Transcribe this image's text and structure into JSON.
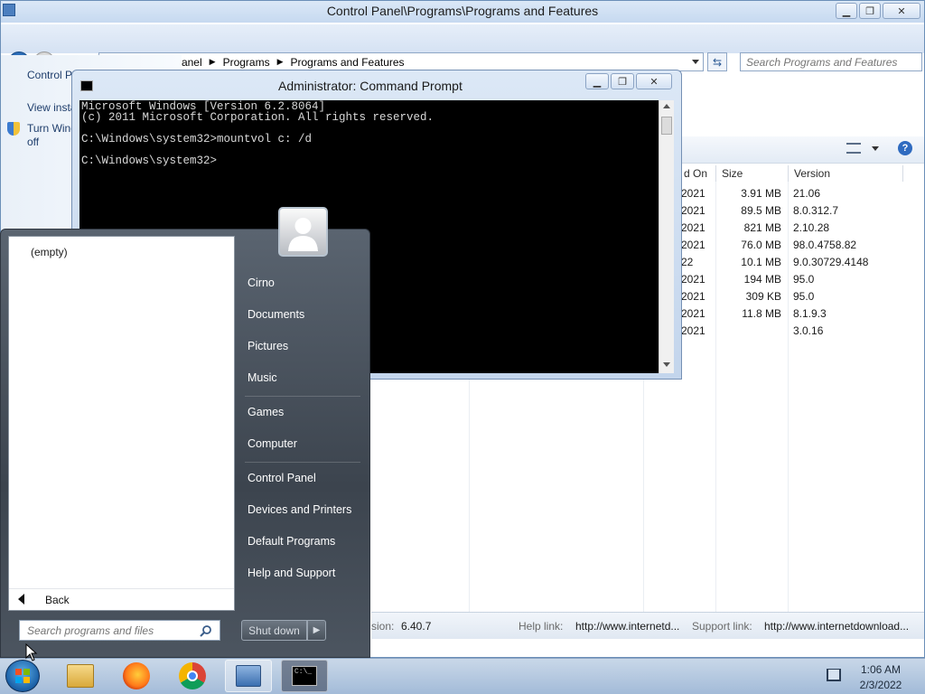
{
  "control_panel": {
    "title": "Control Panel\\Programs\\Programs and Features",
    "breadcrumb": [
      "Control Panel",
      "Programs",
      "Programs and Features"
    ],
    "search_placeholder": "Search Programs and Features",
    "left_links": [
      "Control Panel Home",
      "View installed updates",
      "Turn Windows features on or",
      "off"
    ],
    "columns": {
      "installed_on": "d On",
      "size": "Size",
      "version": "Version"
    },
    "rows": [
      {
        "installed": "2021",
        "size": "3.91 MB",
        "version": "21.06"
      },
      {
        "installed": "2021",
        "size": "89.5 MB",
        "version": "8.0.312.7"
      },
      {
        "installed": "2021",
        "size": "821 MB",
        "version": "2.10.28"
      },
      {
        "installed": "2021",
        "size": "76.0 MB",
        "version": "98.0.4758.82"
      },
      {
        "installed": "22",
        "size": "10.1 MB",
        "version": "9.0.30729.4148"
      },
      {
        "installed": "2021",
        "size": "194 MB",
        "version": "95.0"
      },
      {
        "installed": "2021",
        "size": "309 KB",
        "version": "95.0"
      },
      {
        "installed": "2021",
        "size": "11.8 MB",
        "version": "8.1.9.3"
      },
      {
        "installed": "2021",
        "size": "",
        "version": "3.0.16"
      }
    ],
    "details": {
      "version_label": "sion:",
      "version_value": "6.40.7",
      "help_label": "Help link:",
      "help_value": "http://www.internetd...",
      "support_label": "Support link:",
      "support_value": "http://www.internetdownload..."
    }
  },
  "cmd": {
    "title": "Administrator: Command Prompt",
    "lines": [
      "Microsoft Windows [Version 6.2.8064]",
      "(c) 2011 Microsoft Corporation. All rights reserved.",
      "",
      "C:\\Windows\\system32>mountvol c: /d",
      "",
      "C:\\Windows\\system32>"
    ]
  },
  "start_menu": {
    "programs_empty": "(empty)",
    "back_label": "Back",
    "search_placeholder": "Search programs and files",
    "right_items": [
      "Cirno",
      "Documents",
      "Pictures",
      "Music",
      "Games",
      "Computer",
      "Control Panel",
      "Devices and Printers",
      "Default Programs",
      "Help and Support"
    ],
    "shutdown_label": "Shut down"
  },
  "taskbar": {
    "time": "1:06 AM",
    "date": "2/3/2022"
  }
}
